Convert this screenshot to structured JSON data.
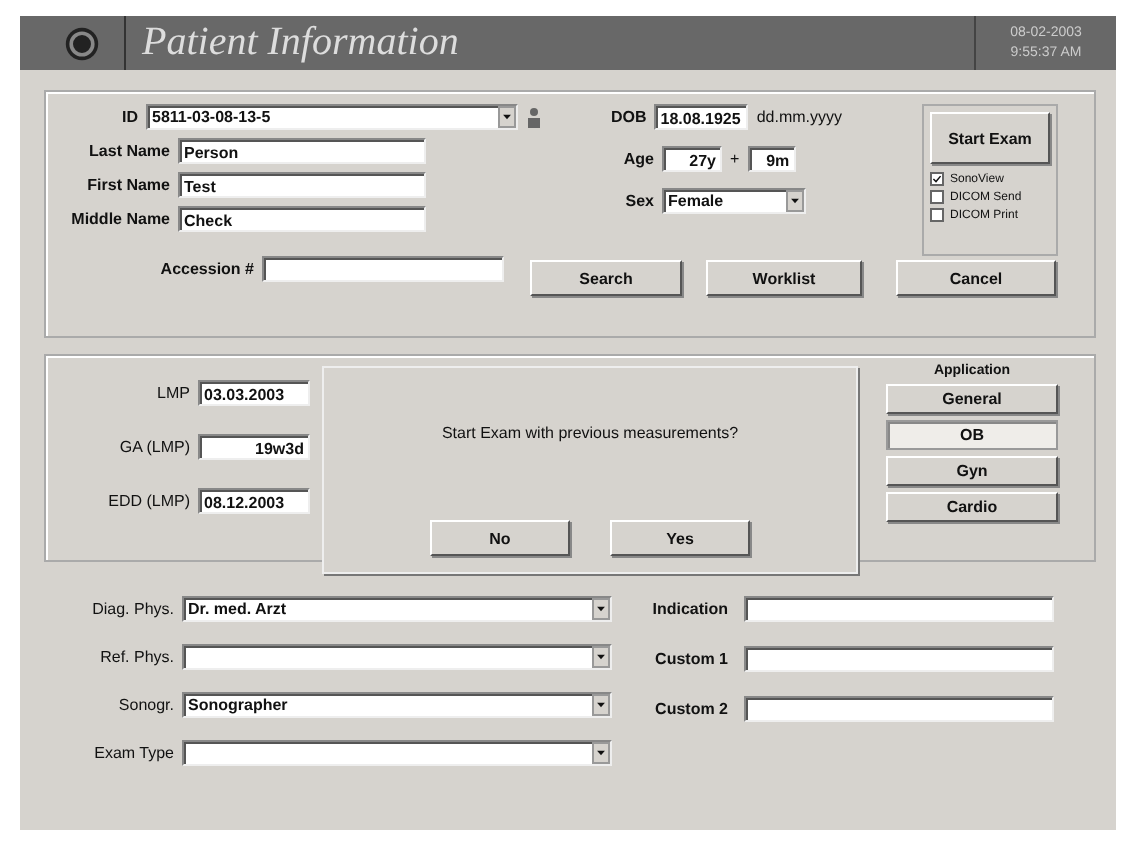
{
  "window": {
    "title": "Patient Information",
    "date": "08-02-2003",
    "time": "9:55:37 AM"
  },
  "patient": {
    "id": "5811-03-08-13-5",
    "last_name_label": "Last Name",
    "last_name": "Person",
    "first_name_label": "First Name",
    "first_name": "Test",
    "middle_name_label": "Middle Name",
    "middle_name": "Check",
    "accession_label": "Accession #",
    "id_label": "ID",
    "dob_label": "DOB",
    "dob": "18.08.1925",
    "dob_format": "dd.mm.yyyy",
    "age_label": "Age",
    "age_years": "27y",
    "age_plus": "+",
    "age_months": "9m",
    "sex_label": "Sex",
    "sex": "Female"
  },
  "exam_box": {
    "start_button": "Start Exam",
    "options": [
      {
        "label": "SonoView",
        "checked": true
      },
      {
        "label": "DICOM Send",
        "checked": false
      },
      {
        "label": "DICOM Print",
        "checked": false
      }
    ]
  },
  "buttons": [
    "Search",
    "Worklist",
    "Cancel"
  ],
  "ob": [
    {
      "label": "LMP",
      "value": "03.03.2003",
      "kind": "date"
    },
    {
      "label": "GA (LMP)",
      "value": "19w3d",
      "kind": "duration"
    },
    {
      "label": "EDD (LMP)",
      "value": "08.12.2003",
      "kind": "date"
    }
  ],
  "application": {
    "title": "Application",
    "items": [
      {
        "label": "General",
        "selected": false
      },
      {
        "label": "OB",
        "selected": true
      },
      {
        "label": "Gyn",
        "selected": false
      },
      {
        "label": "Cardio",
        "selected": false
      }
    ]
  },
  "dialog": {
    "message": "Start Exam with previous measurements?",
    "buttons": [
      "No",
      "Yes"
    ]
  },
  "staff": [
    {
      "label": "Diag. Phys.",
      "value": "Dr. med. Arzt"
    },
    {
      "label": "Ref. Phys."
    },
    {
      "label": "Sonogr.",
      "value": "Sonographer"
    },
    {
      "label": "Exam Type"
    }
  ],
  "custom": [
    {
      "label": "Indication"
    },
    {
      "label": "Custom 1"
    },
    {
      "label": "Custom 2"
    }
  ]
}
